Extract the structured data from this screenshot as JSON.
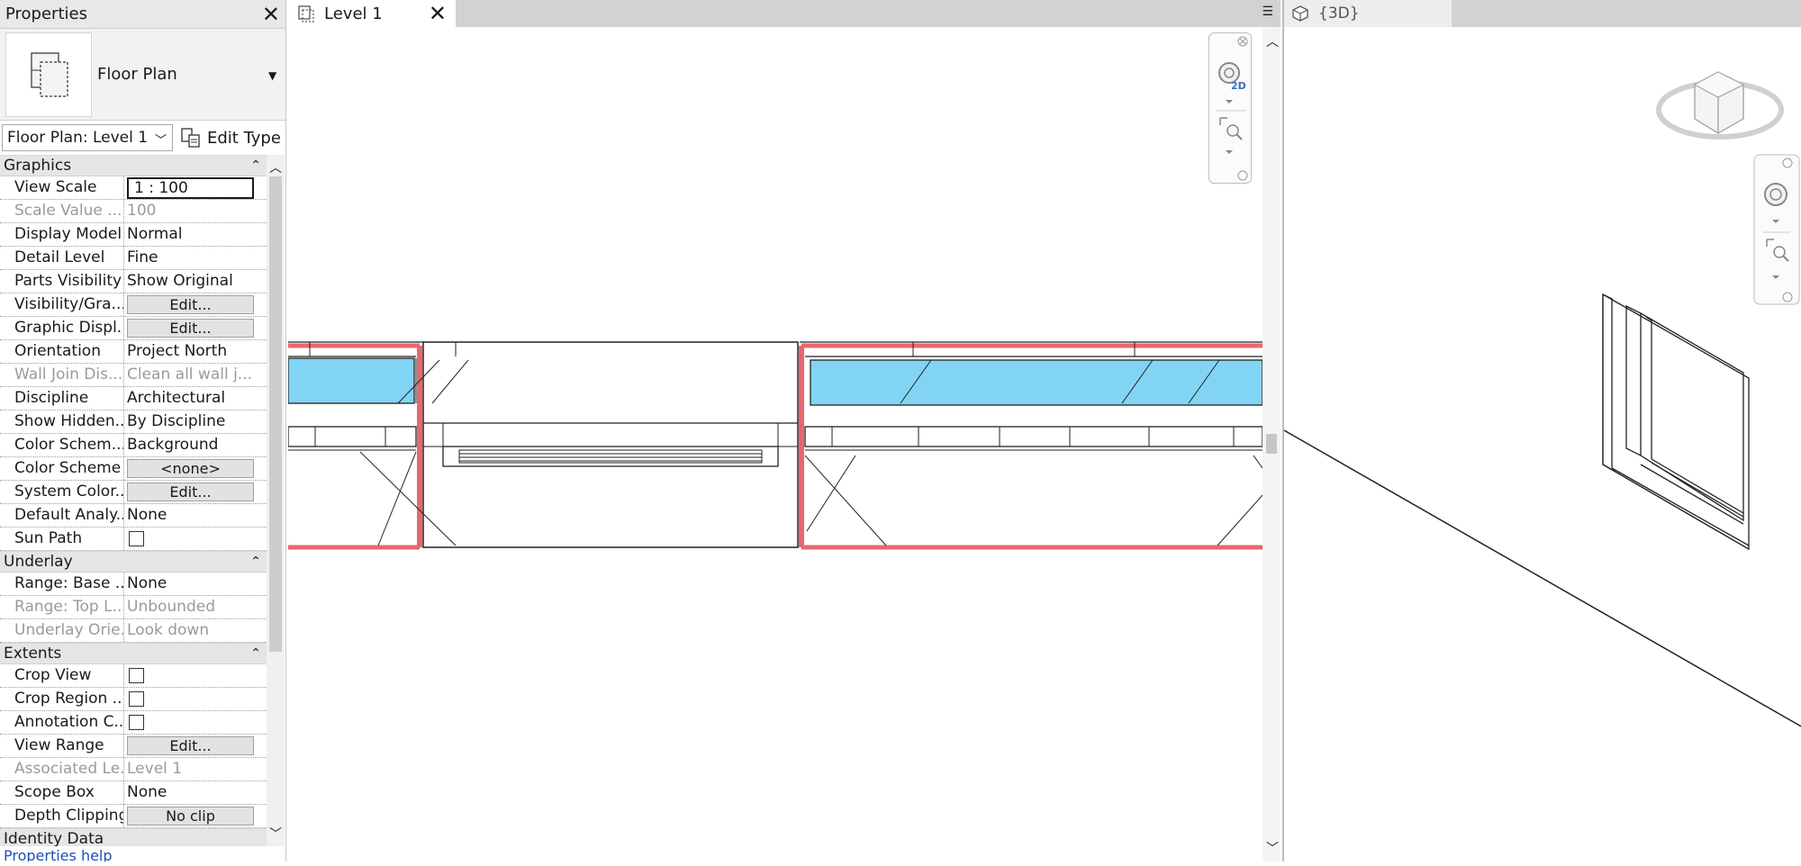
{
  "properties": {
    "title": "Properties",
    "type_name": "Floor Plan",
    "instance_selector": "Floor Plan: Level 1",
    "edit_type": "Edit Type",
    "help_link": "Properties help",
    "groups": {
      "graphics": "Graphics",
      "underlay": "Underlay",
      "extents": "Extents",
      "identity": "Identity Data"
    },
    "rows": {
      "view_scale": {
        "name": "View Scale",
        "value": "1 : 100"
      },
      "scale_value": {
        "name": "Scale Value  ...",
        "value": "100"
      },
      "display_model": {
        "name": "Display Model",
        "value": "Normal"
      },
      "detail_level": {
        "name": "Detail Level",
        "value": "Fine"
      },
      "parts_visibility": {
        "name": "Parts Visibility",
        "value": "Show Original"
      },
      "visibility_graphics": {
        "name": "Visibility/Gra...",
        "value": "Edit..."
      },
      "graphic_display": {
        "name": "Graphic Displ...",
        "value": "Edit..."
      },
      "orientation": {
        "name": "Orientation",
        "value": "Project North"
      },
      "wall_join": {
        "name": "Wall Join Dis...",
        "value": "Clean all wall j..."
      },
      "discipline": {
        "name": "Discipline",
        "value": "Architectural"
      },
      "show_hidden": {
        "name": "Show Hidden...",
        "value": "By Discipline"
      },
      "color_scheme_loc": {
        "name": "Color Schem...",
        "value": "Background"
      },
      "color_scheme": {
        "name": "Color Scheme",
        "value": "<none>"
      },
      "system_color": {
        "name": "System Color...",
        "value": "Edit..."
      },
      "default_analysis": {
        "name": "Default Analy...",
        "value": "None"
      },
      "sun_path": {
        "name": "Sun Path",
        "checked": false
      },
      "range_base": {
        "name": "Range: Base ...",
        "value": "None"
      },
      "range_top": {
        "name": "Range: Top L...",
        "value": "Unbounded"
      },
      "underlay_orient": {
        "name": "Underlay Orie...",
        "value": "Look down"
      },
      "crop_view": {
        "name": "Crop View",
        "checked": false
      },
      "crop_region": {
        "name": "Crop Region ...",
        "checked": false
      },
      "annotation_crop": {
        "name": "Annotation C...",
        "checked": false
      },
      "view_range": {
        "name": "View Range",
        "value": "Edit..."
      },
      "associated_level": {
        "name": "Associated Le...",
        "value": "Level 1"
      },
      "scope_box": {
        "name": "Scope Box",
        "value": "None"
      },
      "depth_clipping": {
        "name": "Depth Clipping",
        "value": "No clip"
      }
    }
  },
  "views": {
    "level1_tab": "Level 1",
    "view3d_tab": "{3D}",
    "nav_2d_badge": "2D"
  },
  "colors": {
    "wall_highlight": "#e8676f",
    "glass": "#82d4f4",
    "tab_bar": "#d2d2d2"
  }
}
